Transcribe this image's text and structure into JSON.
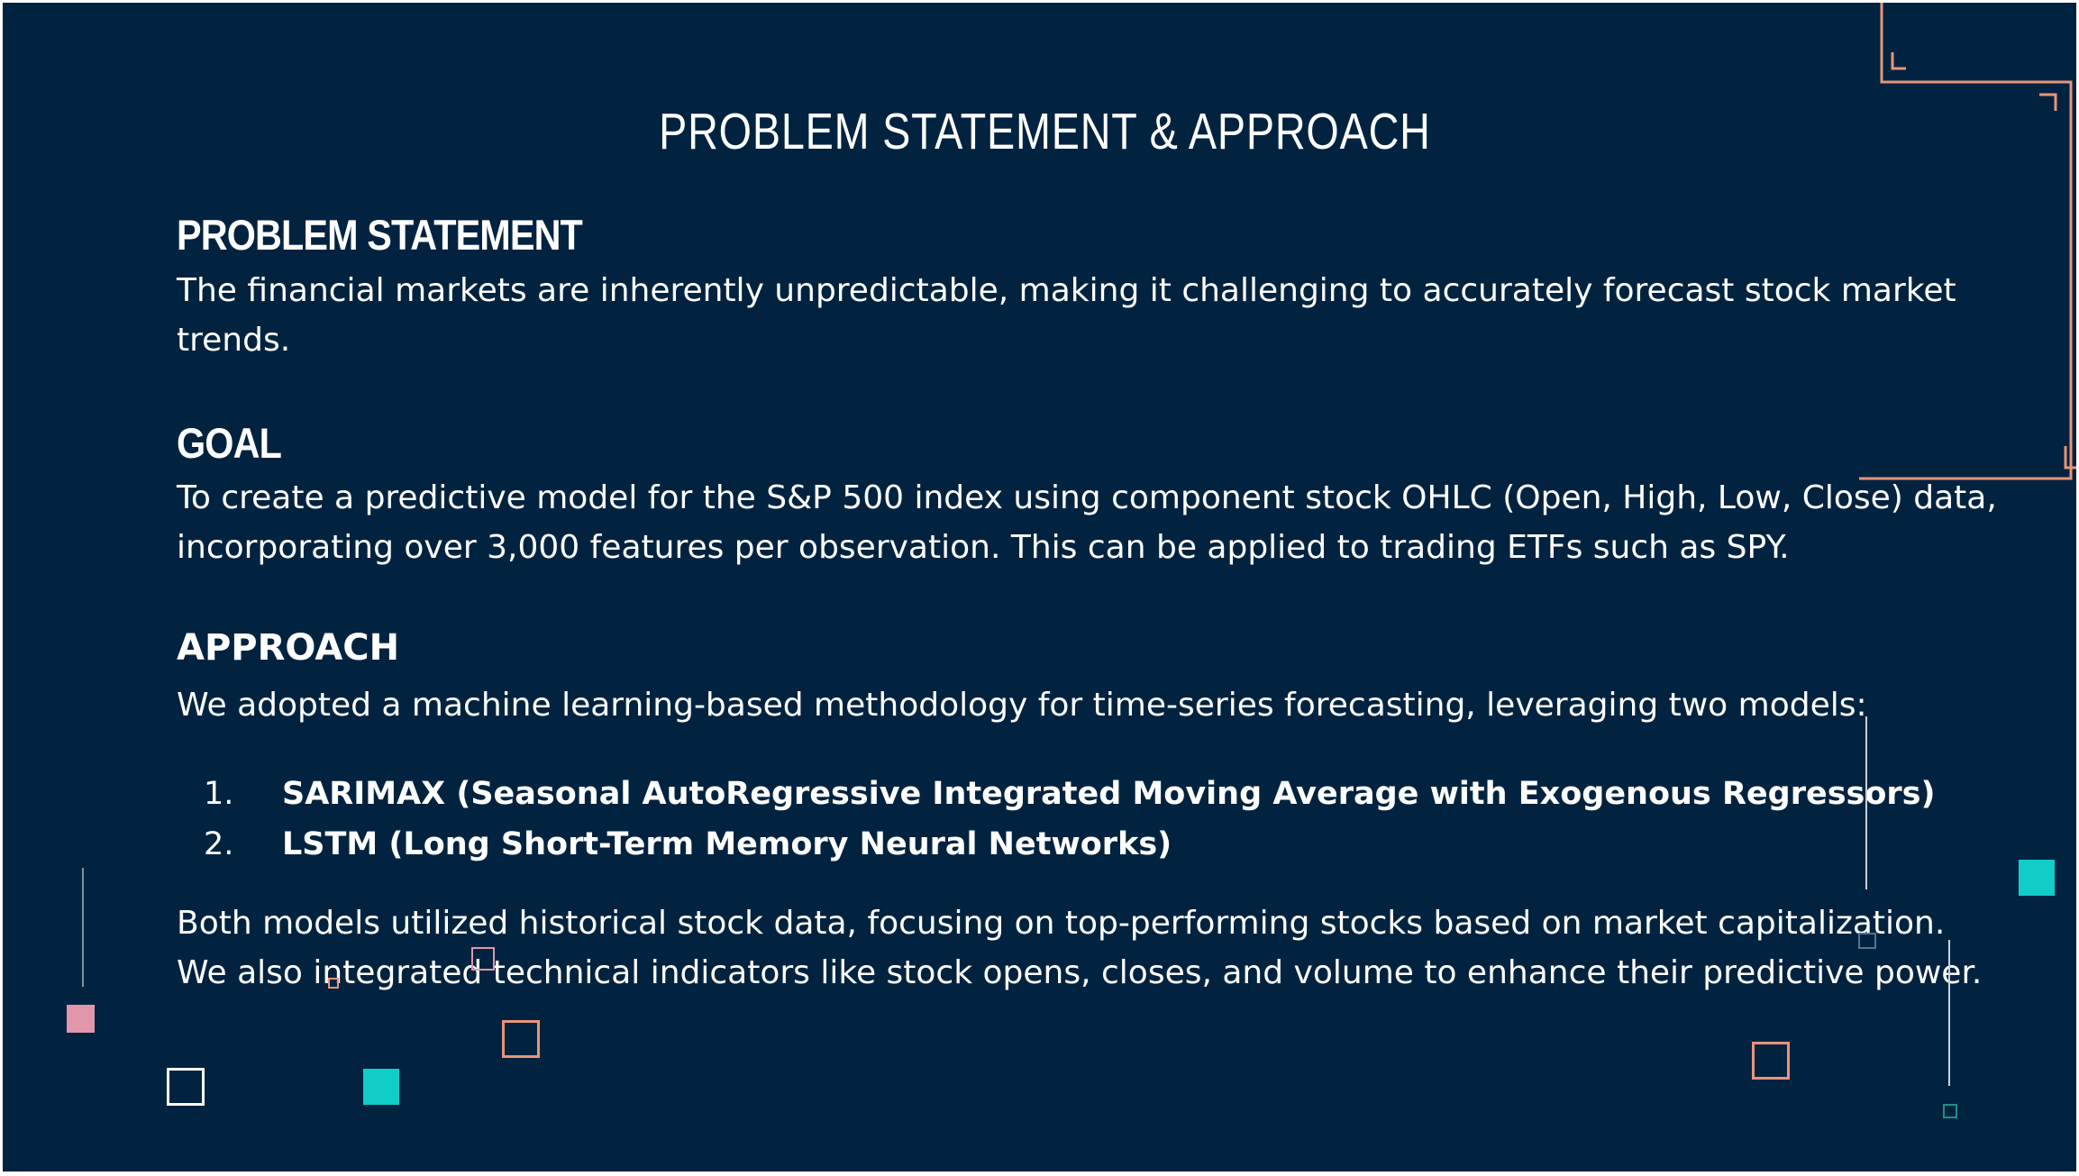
{
  "slide": {
    "title": "PROBLEM STATEMENT & APPROACH",
    "problem": {
      "heading": "PROBLEM STATEMENT",
      "text": "The financial markets are inherently unpredictable, making it challenging to accurately forecast stock market trends."
    },
    "goal": {
      "heading": "GOAL",
      "text": "To create a predictive model for the S&P 500 index using component stock OHLC (Open, High, Low, Close) data, incorporating over 3,000 features per observation. This can be applied to trading ETFs such as SPY."
    },
    "approach": {
      "heading": "APPROACH",
      "intro": "We adopted a machine learning-based methodology for time-series forecasting, leveraging two models:",
      "models": [
        {
          "number": "1.",
          "label": "SARIMAX (Seasonal AutoRegressive Integrated Moving Average with Exogenous Regressors)"
        },
        {
          "number": "2.",
          "label": "LSTM (Long Short-Term Memory Neural Networks)"
        }
      ],
      "conclusion": "Both models utilized historical stock data, focusing on top-performing stocks based on market capitalization. We also integrated technical indicators like stock opens, closes, and volume to enhance their predictive power."
    }
  },
  "colors": {
    "background": "#022340",
    "accent_orange": "#e8957a",
    "accent_teal": "#11cdc8",
    "accent_pink": "#e196aa",
    "text": "#ffffff"
  }
}
